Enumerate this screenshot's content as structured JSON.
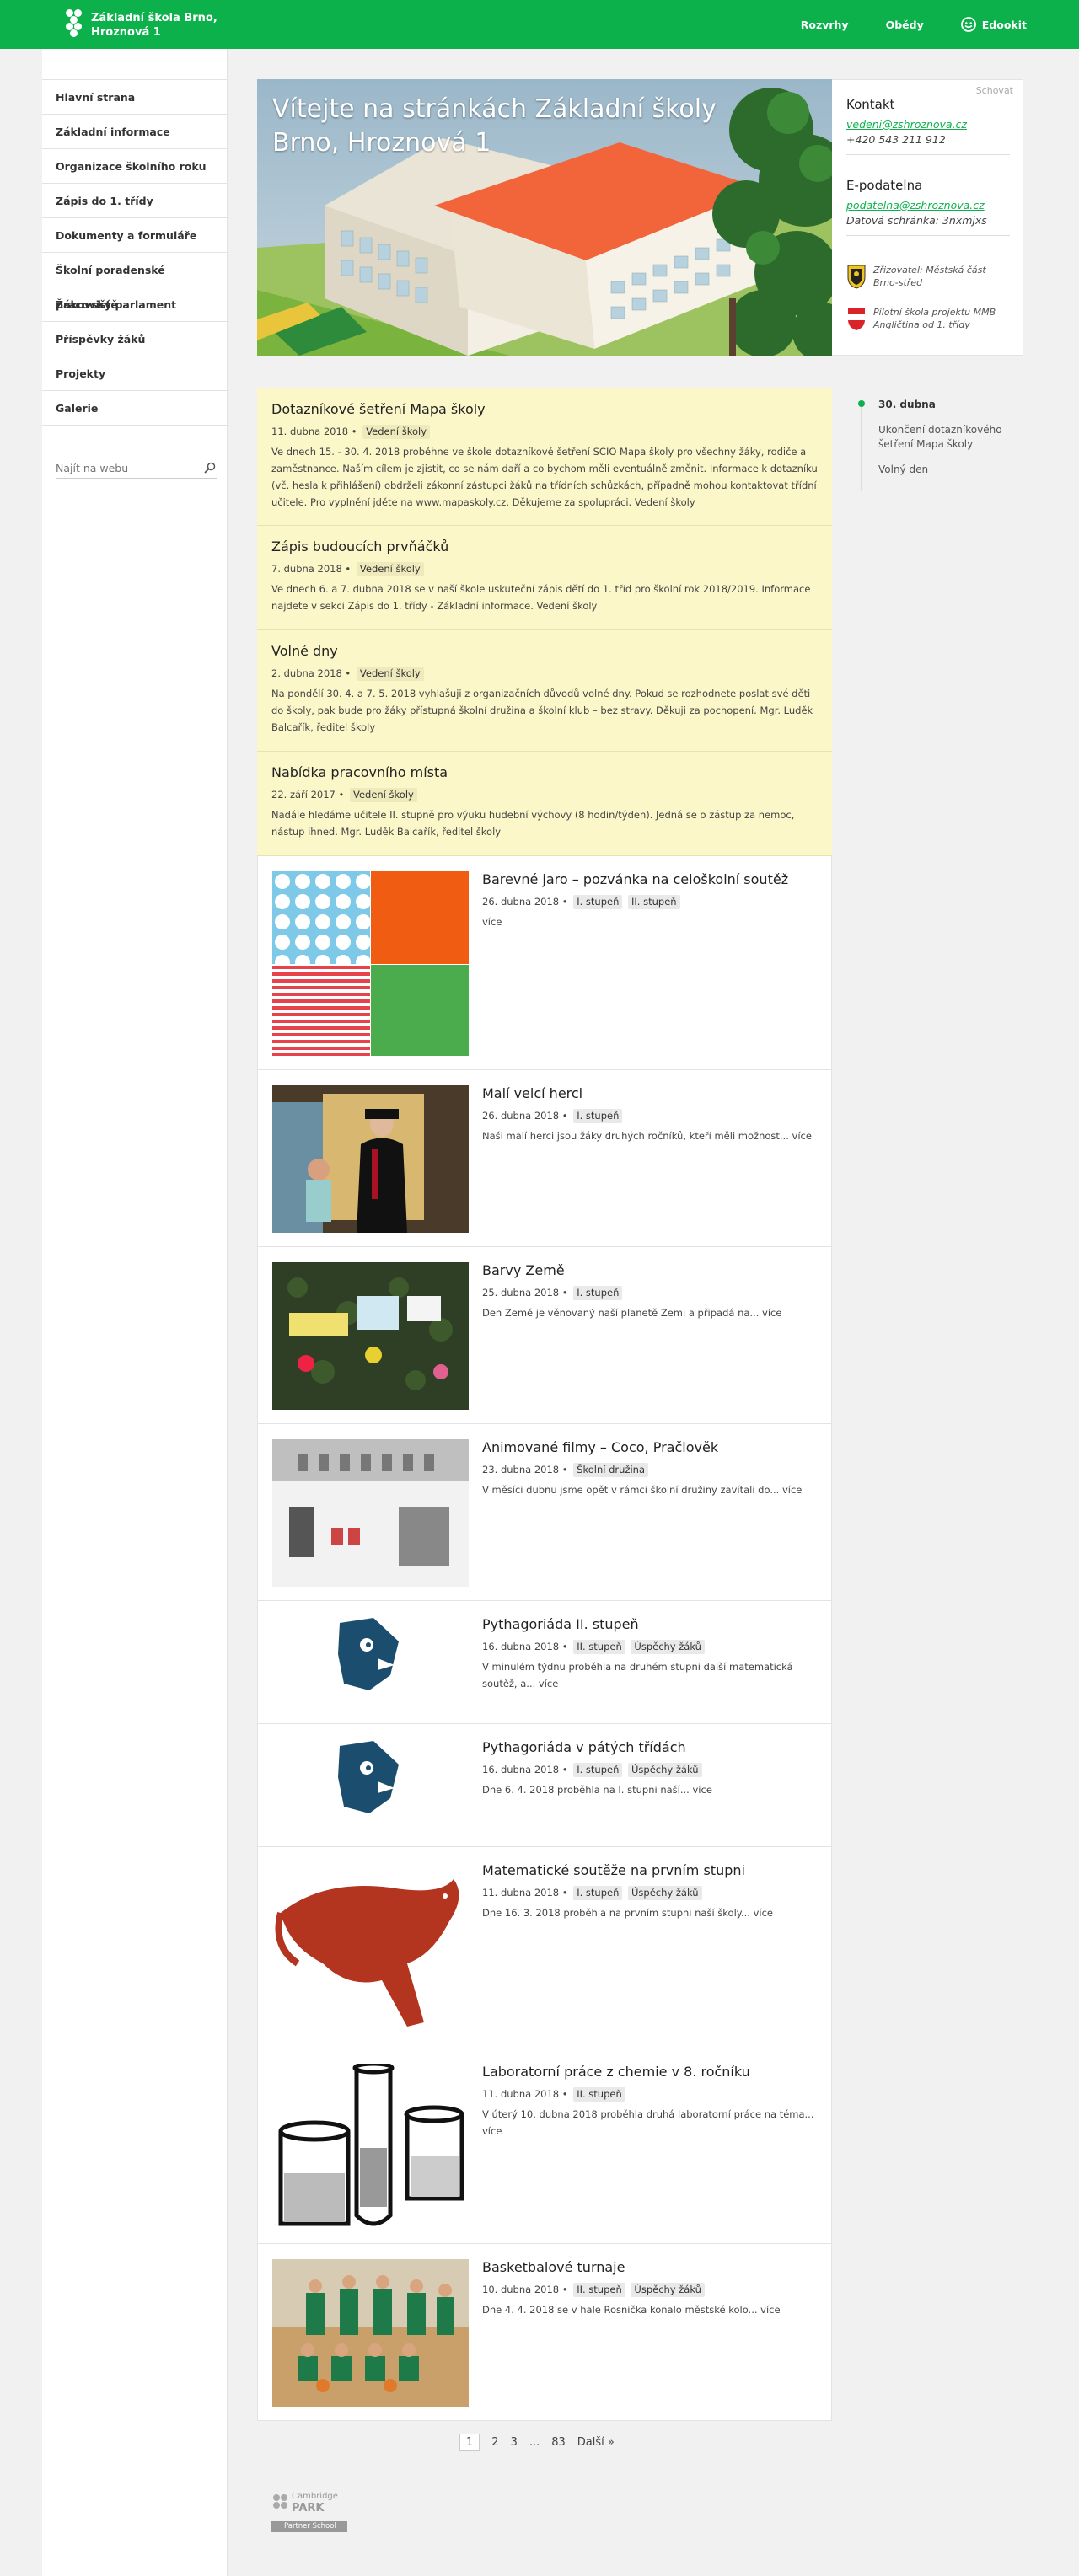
{
  "brand": {
    "line1": "Základní škola Brno,",
    "line2": "Hroznová 1"
  },
  "topnav": [
    {
      "label": "Rozvrhy",
      "icon": ""
    },
    {
      "label": "Obědy",
      "icon": ""
    },
    {
      "label": "Edookit",
      "icon": "edookit-icon"
    }
  ],
  "sidebar": {
    "items": [
      {
        "label": "Hlavní strana"
      },
      {
        "label": "Základní informace"
      },
      {
        "label": "Organizace školního roku"
      },
      {
        "label": "Zápis do 1. třídy"
      },
      {
        "label": "Dokumenty a formuláře"
      },
      {
        "label": "Školní poradenské pracoviště"
      },
      {
        "label": "Žákovský parlament"
      },
      {
        "label": "Příspěvky žáků"
      },
      {
        "label": "Projekty"
      },
      {
        "label": "Galerie"
      }
    ],
    "search_placeholder": "Najít na webu"
  },
  "hero": {
    "title": "Vítejte na stránkách Základní školy Brno, Hroznová 1"
  },
  "infobox": {
    "hide_label": "Schovat",
    "contact_title": "Kontakt",
    "email": "vedeni@zshroznova.cz",
    "phone": "+420 543 211 912",
    "epodatelna_title": "E-podatelna",
    "epodatelna_email": "podatelna@zshroznova.cz",
    "datova_schranka": "Datová schránka: 3nxmjxs",
    "badge1": "Zřizovatel: Městská část Brno-střed",
    "badge2": "Pilotní škola projektu MMB Angličtina od 1. třídy"
  },
  "notices": [
    {
      "title": "Dotazníkové šetření Mapa školy",
      "date": "11. dubna 2018",
      "tag": "Vedení školy",
      "text": "Ve dnech 15. - 30. 4. 2018 proběhne ve škole dotazníkové šetření SCIO Mapa školy pro všechny žáky, rodiče a zaměstnance. Naším cílem je zjistit, co se nám daří a co bychom měli eventuálně změnit. Informace k dotazníku (vč. hesla k přihlášení) obdrželi zákonní zástupci žáků na třídních schůzkách, případně mohou kontaktovat třídní učitele. Pro vyplnění jděte na www.mapaskoly.cz. Děkujeme za spolupráci. Vedení školy"
    },
    {
      "title": "Zápis budoucích prvňáčků",
      "date": "7. dubna 2018",
      "tag": "Vedení školy",
      "text": "Ve dnech 6. a 7. dubna 2018 se v naší škole uskuteční zápis dětí do 1. tříd pro školní rok 2018/2019. Informace najdete v sekci Zápis do 1. třídy - Základní informace. Vedení školy"
    },
    {
      "title": "Volné dny",
      "date": "2. dubna 2018",
      "tag": "Vedení školy",
      "text": "Na pondělí 30. 4. a 7. 5. 2018 vyhlašuji z organizačních důvodů volné dny. Pokud se rozhodnete poslat své děti do školy, pak bude pro žáky přístupná školní družina a školní klub – bez stravy. Děkuji za pochopení. Mgr. Luděk Balcařík, ředitel školy"
    },
    {
      "title": "Nabídka pracovního místa",
      "date": "22. září 2017",
      "tag": "Vedení školy",
      "text": "Nadále hledáme učitele II. stupně pro výuku hudební výchovy (8 hodin/týden). Jedná se o zástup za nemoc, nástup ihned. Mgr. Luděk Balcařík, ředitel školy"
    }
  ],
  "articles": [
    {
      "title": "Barevné jaro – pozvánka na celoškolní soutěž",
      "date": "26. dubna 2018",
      "tags": [
        "I. stupeň",
        "II. stupeň"
      ],
      "text": "více",
      "image": "polka-dot-collage"
    },
    {
      "title": "Malí velcí herci",
      "date": "26. dubna 2018",
      "tags": [
        "I. stupeň"
      ],
      "text": "Naši malí herci jsou žáky druhých ročníků, kteří měli možnost... více",
      "image": "theatre-photo"
    },
    {
      "title": "Barvy Země",
      "date": "25. dubna 2018",
      "tags": [
        "I. stupeň"
      ],
      "text": "Den Země je věnovaný naší planetě Zemi a připadá na... více",
      "image": "earth-day-board"
    },
    {
      "title": "Animované filmy – Coco, Pračlověk",
      "date": "23. dubna 2018",
      "tags": [
        "Školní družina"
      ],
      "text": "V měsíci dubnu jsme opět v rámci školní družiny zavítali do... více",
      "image": "lucerna-cinema"
    },
    {
      "title": "Pythagoriáda II. stupeň",
      "date": "16. dubna 2018",
      "tags": [
        "II. stupeň",
        "Úspěchy žáků"
      ],
      "text": "V minulém týdnu proběhla na druhém stupni další matematická soutěž, a... více",
      "image": "pythagoriada-logo"
    },
    {
      "title": "Pythagoriáda v pátých třídách",
      "date": "16. dubna 2018",
      "tags": [
        "I. stupeň",
        "Úspěchy žáků"
      ],
      "text": "Dne 6. 4. 2018 proběhla na I. stupni naší... více",
      "image": "pythagoriada-logo"
    },
    {
      "title": "Matematické soutěže na prvním stupni",
      "date": "11. dubna 2018",
      "tags": [
        "I. stupeň",
        "Úspěchy žáků"
      ],
      "text": "Dne 16. 3. 2018 proběhla na prvním stupni naší školy... více",
      "image": "math-kangaroo"
    },
    {
      "title": "Laboratorní práce z chemie v 8. ročníku",
      "date": "11. dubna 2018",
      "tags": [
        "II. stupeň"
      ],
      "text": "V úterý 10. dubna 2018 proběhla druhá laboratorní práce na téma... více",
      "image": "lab-beakers"
    },
    {
      "title": "Basketbalové turnaje",
      "date": "10. dubna 2018",
      "tags": [
        "II. stupeň",
        "Úspěchy žáků"
      ],
      "text": "Dne 4. 4. 2018 se v hale Rosnička konalo městské kolo... více",
      "image": "basketball-team"
    }
  ],
  "timeline": {
    "date": "30. dubna",
    "items": [
      "Ukončení dotazníkového šetření Mapa školy",
      "Volný den"
    ]
  },
  "pager": {
    "pages": [
      "1",
      "2",
      "3",
      "...",
      "83"
    ],
    "next": "Další »",
    "current": "1"
  },
  "footer": {
    "logo_top": "Cambridge",
    "logo_mid": "PARK",
    "logo_bottom": "Partner School"
  },
  "colors": {
    "accent": "#0db14b",
    "notice_bg": "#fbf7c9"
  }
}
